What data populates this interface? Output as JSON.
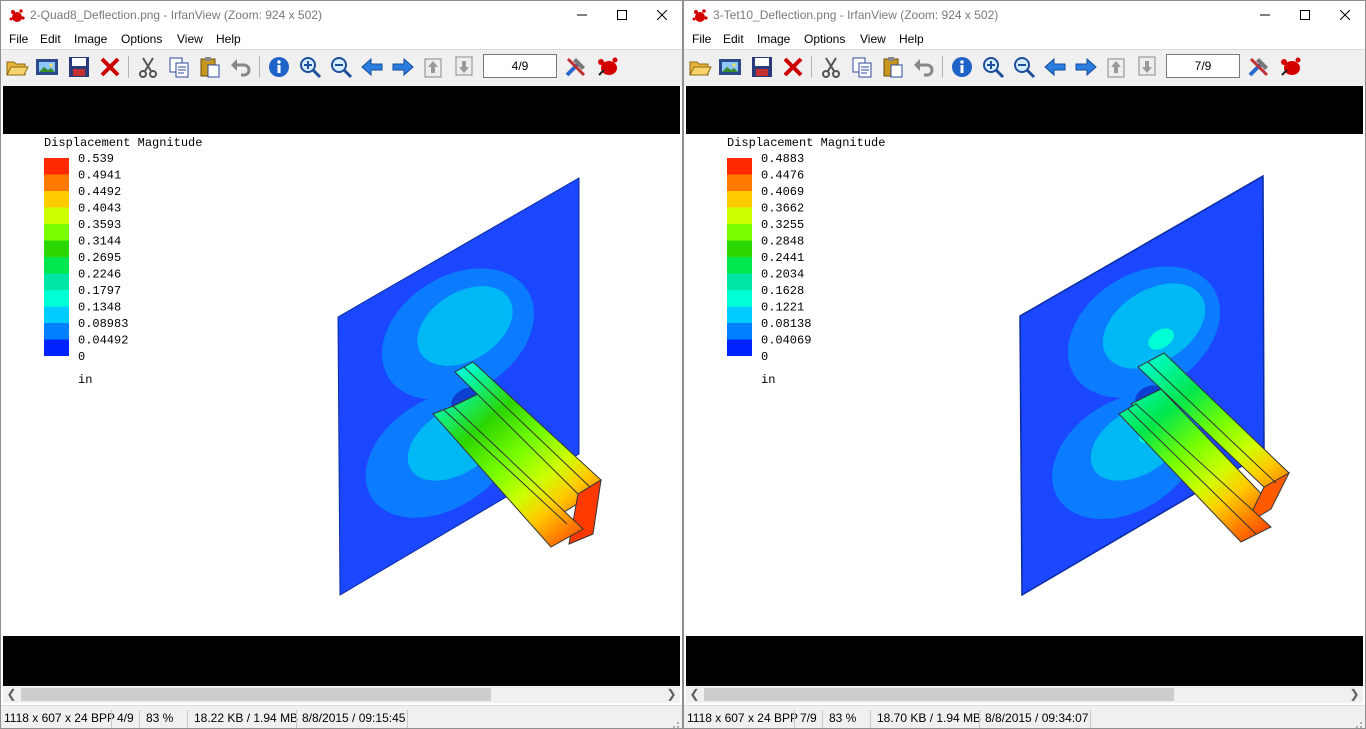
{
  "menu": [
    "File",
    "Edit",
    "Image",
    "Options",
    "View",
    "Help"
  ],
  "colors": {
    "bands": [
      "#ff2a00",
      "#ff7a00",
      "#ffcc00",
      "#ccff00",
      "#7aff00",
      "#2cd600",
      "#00e64d",
      "#00e6a6",
      "#00ffd5",
      "#00ccff",
      "#0080ff",
      "#0024ff"
    ],
    "plate": "#1a47ff",
    "accent_close": "#cc0000"
  },
  "toolbar_icons": [
    "open-icon",
    "thumbnails-icon",
    "save-icon",
    "delete-icon",
    "cut-icon",
    "copy-icon",
    "paste-icon",
    "undo-icon",
    "info-icon",
    "zoom-in-icon",
    "zoom-out-icon",
    "previous-icon",
    "next-icon",
    "first-page-icon",
    "last-page-icon",
    "settings-icon",
    "irfanview-icon"
  ],
  "left": {
    "title": "2-Quad8_Deflection.png - IrfanView (Zoom: 924 x 502)",
    "page": "4/9",
    "legend": {
      "title": "Displacement Magnitude",
      "values": [
        "0.539",
        "0.4941",
        "0.4492",
        "0.4043",
        "0.3593",
        "0.3144",
        "0.2695",
        "0.2246",
        "0.1797",
        "0.1348",
        "0.08983",
        "0.04492",
        "0"
      ],
      "unit": "in"
    },
    "status": {
      "dims": "1118 x 607 x 24 BPP",
      "page": "4/9",
      "zoom": "83 %",
      "size": "18.22 KB / 1.94 MB",
      "datetime": "8/8/2015 / 09:15:45"
    }
  },
  "right": {
    "title": "3-Tet10_Deflection.png - IrfanView (Zoom: 924 x 502)",
    "page": "7/9",
    "legend": {
      "title": "Displacement Magnitude",
      "values": [
        "0.4883",
        "0.4476",
        "0.4069",
        "0.3662",
        "0.3255",
        "0.2848",
        "0.2441",
        "0.2034",
        "0.1628",
        "0.1221",
        "0.08138",
        "0.04069",
        "0"
      ],
      "unit": "in"
    },
    "status": {
      "dims": "1118 x 607 x 24 BPP",
      "page": "7/9",
      "zoom": "83 %",
      "size": "18.70 KB / 1.94 MB",
      "datetime": "8/8/2015 / 09:34:07"
    }
  }
}
